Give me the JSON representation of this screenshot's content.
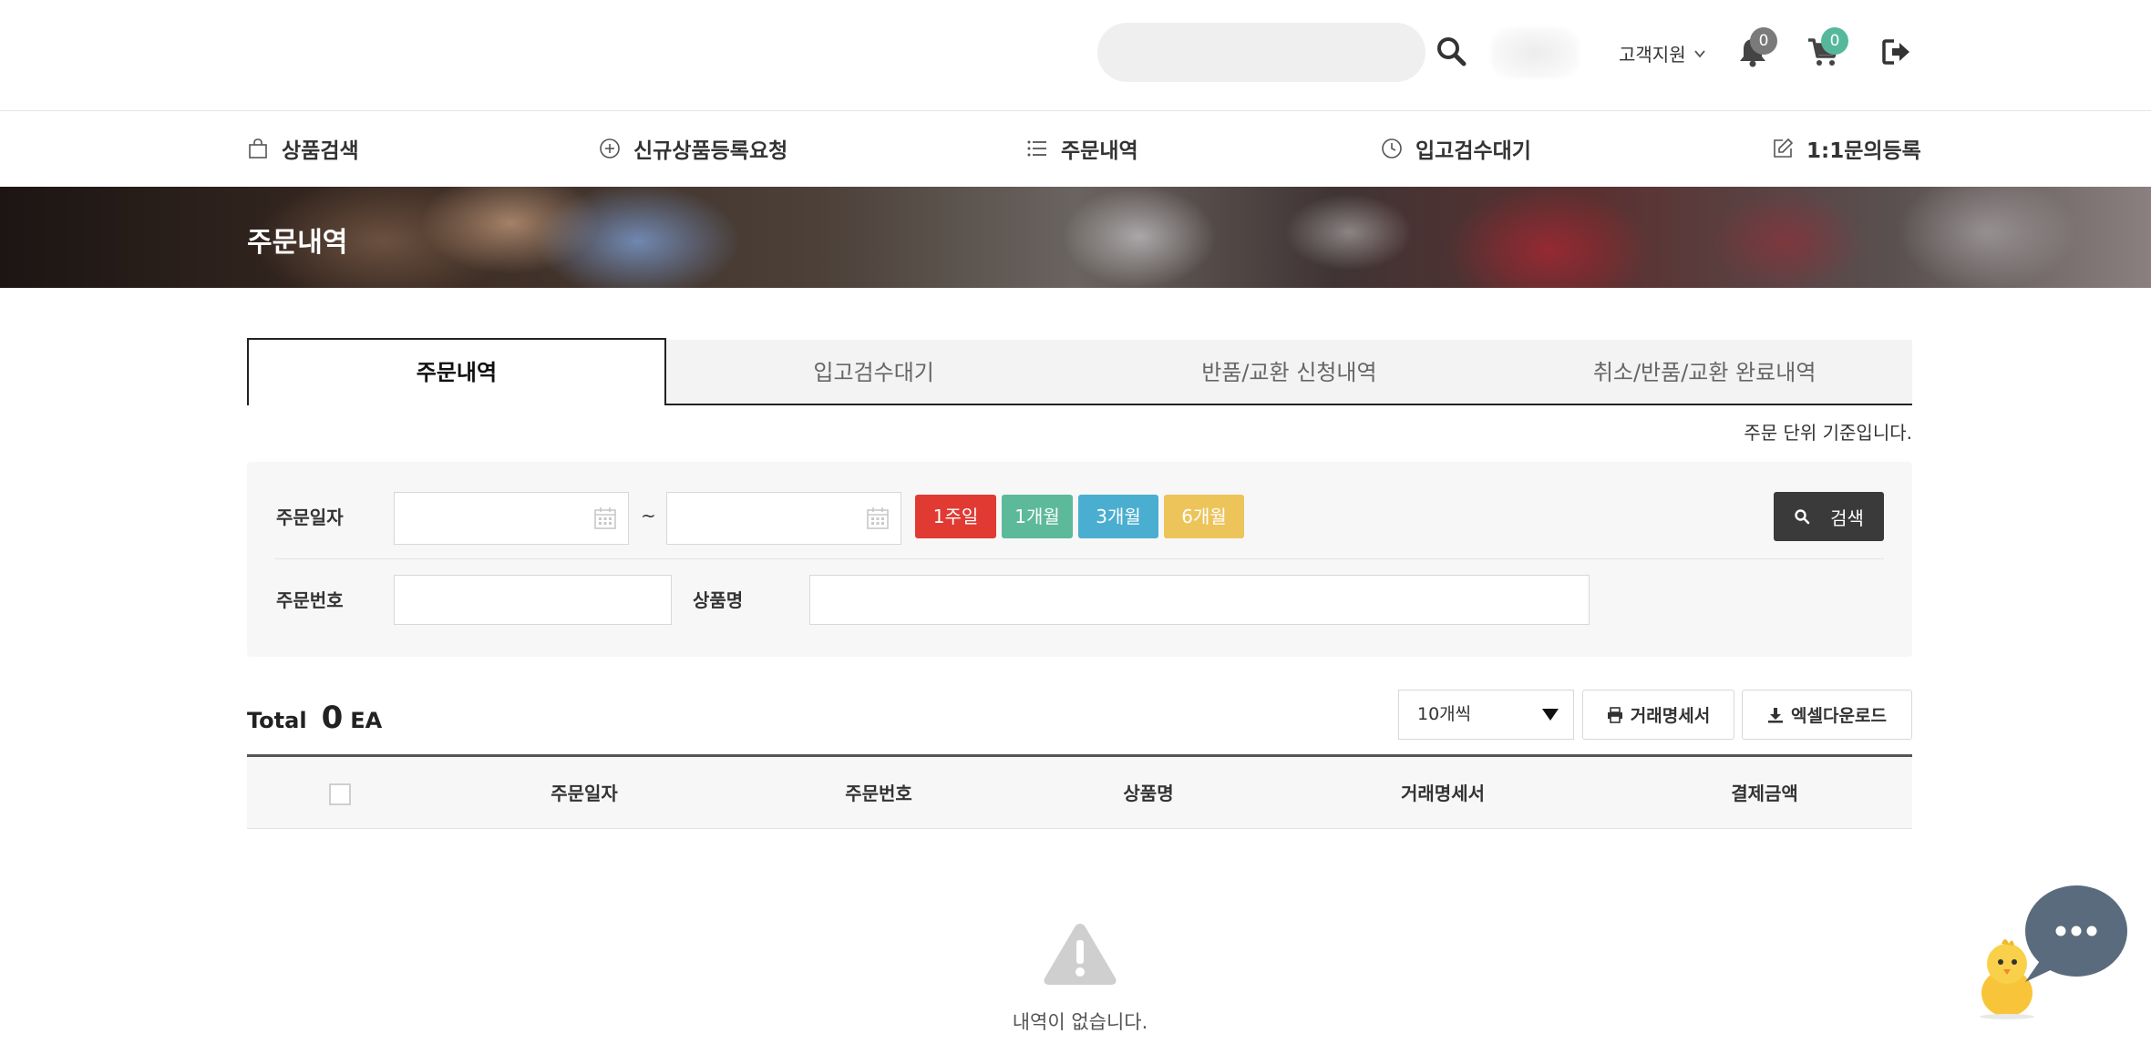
{
  "header": {
    "search_placeholder": "",
    "customer_service_label": "고객지원",
    "notification_count": "0",
    "cart_count": "0"
  },
  "nav": {
    "items": [
      {
        "label": "상품검색",
        "icon": "shopping-bag-icon"
      },
      {
        "label": "신규상품등록요청",
        "icon": "plus-circle-icon"
      },
      {
        "label": "주문내역",
        "icon": "list-icon"
      },
      {
        "label": "입고검수대기",
        "icon": "clock-icon"
      },
      {
        "label": "1:1문의등록",
        "icon": "edit-icon"
      }
    ]
  },
  "banner": {
    "title": "주문내역"
  },
  "tabs": {
    "items": [
      {
        "label": "주문내역",
        "active": true
      },
      {
        "label": "입고검수대기",
        "active": false
      },
      {
        "label": "반품/교환 신청내역",
        "active": false
      },
      {
        "label": "취소/반품/교환 완료내역",
        "active": false
      }
    ]
  },
  "notice": "주문 단위 기준입니다.",
  "filter": {
    "order_date_label": "주문일자",
    "date_from": "",
    "date_to": "",
    "tilde": "~",
    "periods": [
      {
        "label": "1주일",
        "color": "#e03a33"
      },
      {
        "label": "1개월",
        "color": "#5cb99a"
      },
      {
        "label": "3개월",
        "color": "#4aaed0"
      },
      {
        "label": "6개월",
        "color": "#ecc45a"
      }
    ],
    "search_button": "검색",
    "order_number_label": "주문번호",
    "order_number_value": "",
    "product_name_label": "상품명",
    "product_name_value": ""
  },
  "summary": {
    "total_label": "Total",
    "total_count": "0",
    "total_unit": "EA",
    "per_page_selected": "10개씩",
    "statement_button": "거래명세서",
    "excel_button": "엑셀다운로드"
  },
  "table": {
    "columns": [
      "주문일자",
      "주문번호",
      "상품명",
      "거래명세서",
      "결제금액"
    ],
    "empty_message": "내역이 없습니다."
  },
  "colors": {
    "cart_badge": "#56b89b",
    "bell_badge": "#7a7a7a",
    "search_button_bg": "#3a3a3a"
  }
}
